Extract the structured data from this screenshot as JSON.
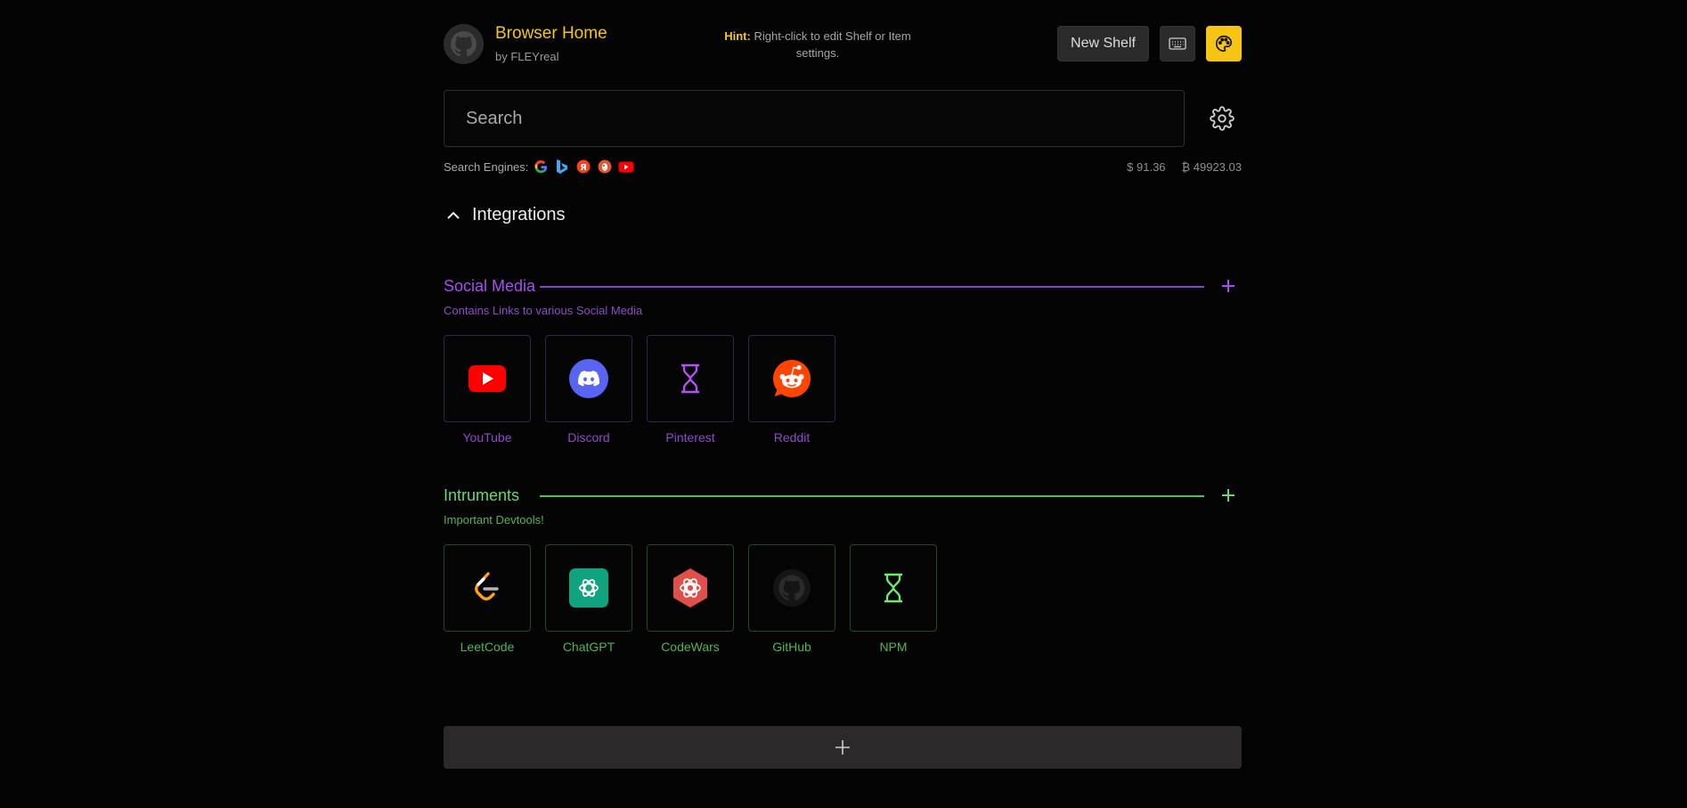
{
  "header": {
    "title": "Browser Home",
    "byline": "by FLEYreal",
    "hint_label": "Hint:",
    "hint_text": " Right-click to edit Shelf or Item settings.",
    "new_shelf_label": "New Shelf"
  },
  "search": {
    "placeholder": "Search",
    "engines_label": "Search Engines:",
    "engines": [
      "google-icon",
      "bing-icon",
      "yandex-icon",
      "duckduckgo-icon",
      "youtube-icon"
    ]
  },
  "rates": {
    "usd": "$ 91.36",
    "btc": "₿ 49923.03"
  },
  "integrations": {
    "label": "Integrations"
  },
  "shelves": [
    {
      "title": "Social Media",
      "description": "Contains Links to various Social Media",
      "color": "#a84df2",
      "items": [
        {
          "label": "YouTube",
          "icon": "youtube-icon"
        },
        {
          "label": "Discord",
          "icon": "discord-icon"
        },
        {
          "label": "Pinterest",
          "icon": "hourglass-icon"
        },
        {
          "label": "Reddit",
          "icon": "reddit-icon"
        }
      ]
    },
    {
      "title": "Intruments",
      "description": "Important Devtools!",
      "color": "#6bd96b",
      "items": [
        {
          "label": "LeetCode",
          "icon": "leetcode-icon"
        },
        {
          "label": "ChatGPT",
          "icon": "chatgpt-icon"
        },
        {
          "label": "CodeWars",
          "icon": "codewars-icon"
        },
        {
          "label": "GitHub",
          "icon": "github-icon"
        },
        {
          "label": "NPM",
          "icon": "hourglass-icon"
        }
      ]
    }
  ],
  "colors": {
    "accent": "#f4c51b",
    "social": "#a84df2",
    "tools": "#6bd96b"
  }
}
